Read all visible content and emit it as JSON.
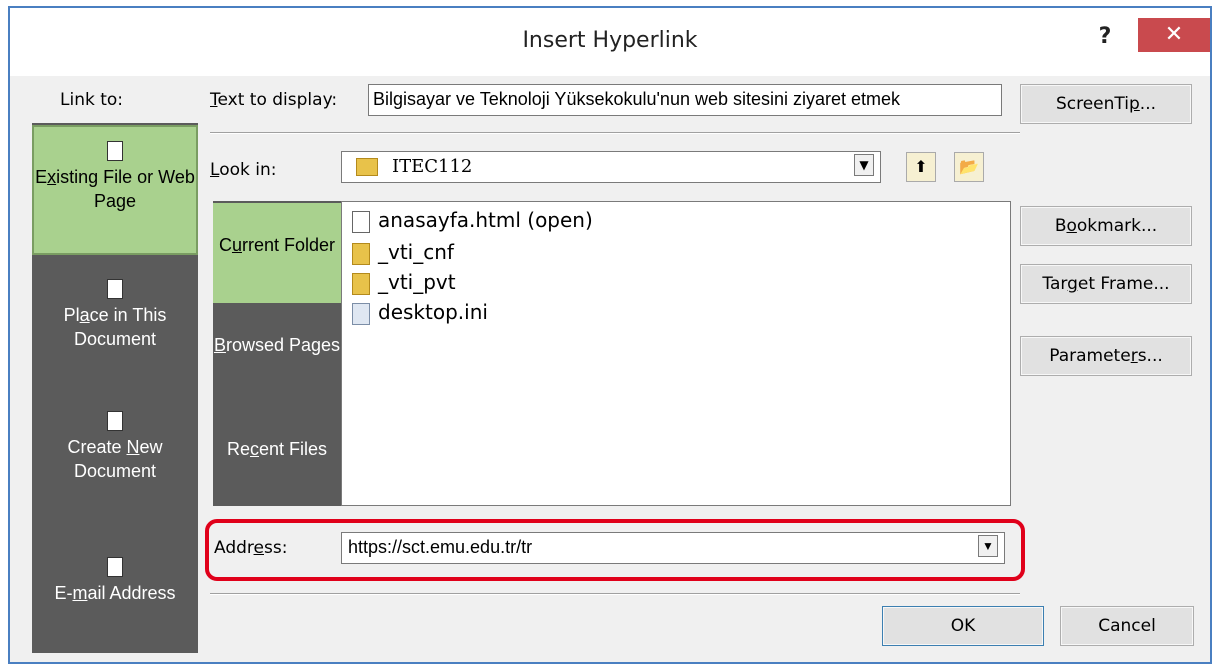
{
  "dialog": {
    "title": "Insert Hyperlink",
    "help": "?",
    "close": "✕"
  },
  "link_to": {
    "label": "Link to:",
    "items": [
      {
        "label_pre": "E",
        "label_u": "x",
        "label_post": "isting File or Web Page",
        "icon": "globe-doc-icon"
      },
      {
        "label_pre": "Pl",
        "label_u": "a",
        "label_post": "ce in This Document",
        "icon": "place-doc-icon"
      },
      {
        "label_pre": "Create ",
        "label_u": "N",
        "label_post": "ew Document",
        "icon": "new-doc-icon"
      },
      {
        "label_pre": "E-",
        "label_u": "m",
        "label_post": "ail Address",
        "icon": "email-icon"
      }
    ]
  },
  "text_to_display": {
    "label_u": "T",
    "label_rest": "ext to display:",
    "value": "Bilgisayar ve Teknoloji Yüksekokulu'nun web sitesini ziyaret etmek"
  },
  "screentip_button": {
    "pre": "ScreenTi",
    "u": "p",
    "post": "..."
  },
  "look_in": {
    "label_u": "L",
    "label_rest": "ook in:",
    "value": "ITEC112"
  },
  "sub_nav": [
    {
      "pre": "C",
      "u": "u",
      "post": "rrent Folder"
    },
    {
      "pre": "",
      "u": "B",
      "post": "rowsed Pages"
    },
    {
      "pre": "Re",
      "u": "c",
      "post": "ent Files"
    }
  ],
  "files": [
    {
      "name": "anasayfa.html (open)",
      "type": "file"
    },
    {
      "name": "_vti_cnf",
      "type": "folder"
    },
    {
      "name": "_vti_pvt",
      "type": "folder"
    },
    {
      "name": "desktop.ini",
      "type": "ini"
    }
  ],
  "right_buttons": {
    "bookmark": {
      "pre": "B",
      "u": "o",
      "post": "okmark..."
    },
    "target_frame": {
      "pre": "Tar",
      "u": "g",
      "post": "et Frame..."
    },
    "parameters": {
      "pre": "Paramete",
      "u": "r",
      "post": "s..."
    }
  },
  "address": {
    "label_pre": "Addr",
    "label_u": "e",
    "label_post": "ss:",
    "value": "https://sct.emu.edu.tr/tr"
  },
  "ok_label": "OK",
  "cancel_label": "Cancel",
  "colors": {
    "selected": "#a9d18e",
    "panel": "#5b5b5b",
    "highlight": "#e0001a",
    "close": "#c94a4e"
  }
}
